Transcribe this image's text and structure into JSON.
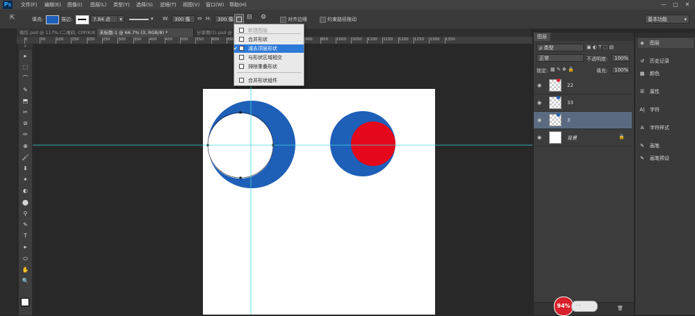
{
  "app": {
    "logo": "Ps"
  },
  "menubar": {
    "items": [
      "文件(F)",
      "编辑(E)",
      "图像(I)",
      "图层(L)",
      "类型(Y)",
      "选择(S)",
      "滤镜(T)",
      "视图(V)",
      "窗口(W)",
      "帮助(H)"
    ]
  },
  "window_controls": [
    "—",
    "▢",
    "✕"
  ],
  "options_bar": {
    "fill_label": "填充:",
    "stroke_label": "描边:",
    "stroke_width": "7.84 点",
    "w_label": "W:",
    "w_value": "300 像",
    "link": "⇔",
    "h_label": "H:",
    "h_value": "300 像",
    "align_edges": "对齐边缘",
    "constrain_path": "约束路径拖动",
    "workspace": "基本功能",
    "fill_color": "#1e5fb8"
  },
  "tabs": [
    {
      "label": "微信.psd @ 117% (二维码, CMYK/8) *",
      "active": false
    },
    {
      "label": "未标题-1 @ 66.7% (3, RGB/8) *",
      "active": true
    },
    {
      "label": "分享图(1).psd @ ...",
      "active": false
    }
  ],
  "ruler": {
    "labels": [
      "0",
      "50",
      "100",
      "150",
      "200",
      "250",
      "300",
      "350",
      "400",
      "450",
      "500",
      "550",
      "600",
      "650",
      "700",
      "750",
      "800",
      "850",
      "900",
      "950",
      "1000",
      "1050",
      "1100",
      "1150",
      "1200",
      "1250",
      "1300",
      "1350"
    ]
  },
  "toolbar": {
    "tools": [
      "▸",
      "⬚",
      "⌒",
      "✎",
      "⬒",
      "✂",
      "⊘",
      "✏",
      "⊕",
      "🖌",
      "⬇",
      "✦",
      "◐",
      "⬤",
      "⚲",
      "✎",
      "T",
      "▸",
      "⬭",
      "✋",
      "🔍"
    ]
  },
  "path_menu": {
    "items": [
      {
        "label": "新建图层",
        "state": "disabled"
      },
      {
        "label": "合并形状",
        "state": "normal"
      },
      {
        "label": "减去顶层形状",
        "state": "highlighted",
        "checked": true
      },
      {
        "label": "与形状区域相交",
        "state": "normal"
      },
      {
        "label": "排除重叠形状",
        "state": "normal"
      },
      {
        "label": "合并形状组件",
        "state": "normal"
      }
    ]
  },
  "layers_panel": {
    "tab": "图层",
    "filter_label": "ρ 类型",
    "blend_mode": "正常",
    "opacity_label": "不透明度:",
    "opacity_value": "100%",
    "lock_label": "锁定:",
    "fill_label": "填充:",
    "fill_value": "100%",
    "layers": [
      {
        "name": "22",
        "selected": false,
        "dot": "#d8202a"
      },
      {
        "name": "33",
        "selected": false,
        "dot": "#1e5fb8"
      },
      {
        "name": "3",
        "selected": true,
        "dot": "#1e5fb8"
      },
      {
        "name": "背景",
        "selected": false,
        "dot": ""
      }
    ]
  },
  "side_dock": {
    "items": [
      {
        "icon": "◈",
        "label": "图层"
      },
      {
        "icon": "↺",
        "label": "历史记录"
      },
      {
        "icon": "▦",
        "label": "颜色"
      },
      {
        "icon": "☰",
        "label": "属性"
      },
      {
        "icon": "A|",
        "label": "字符"
      },
      {
        "icon": "A",
        "label": "字符样式"
      },
      {
        "icon": "✎",
        "label": "画笔"
      },
      {
        "icon": "✎",
        "label": "画笔预设"
      }
    ]
  },
  "badge": {
    "label": "94%"
  },
  "colors": {
    "blue": "#1e5fb8",
    "red": "#e4081a",
    "guide": "#3fd6e0"
  }
}
